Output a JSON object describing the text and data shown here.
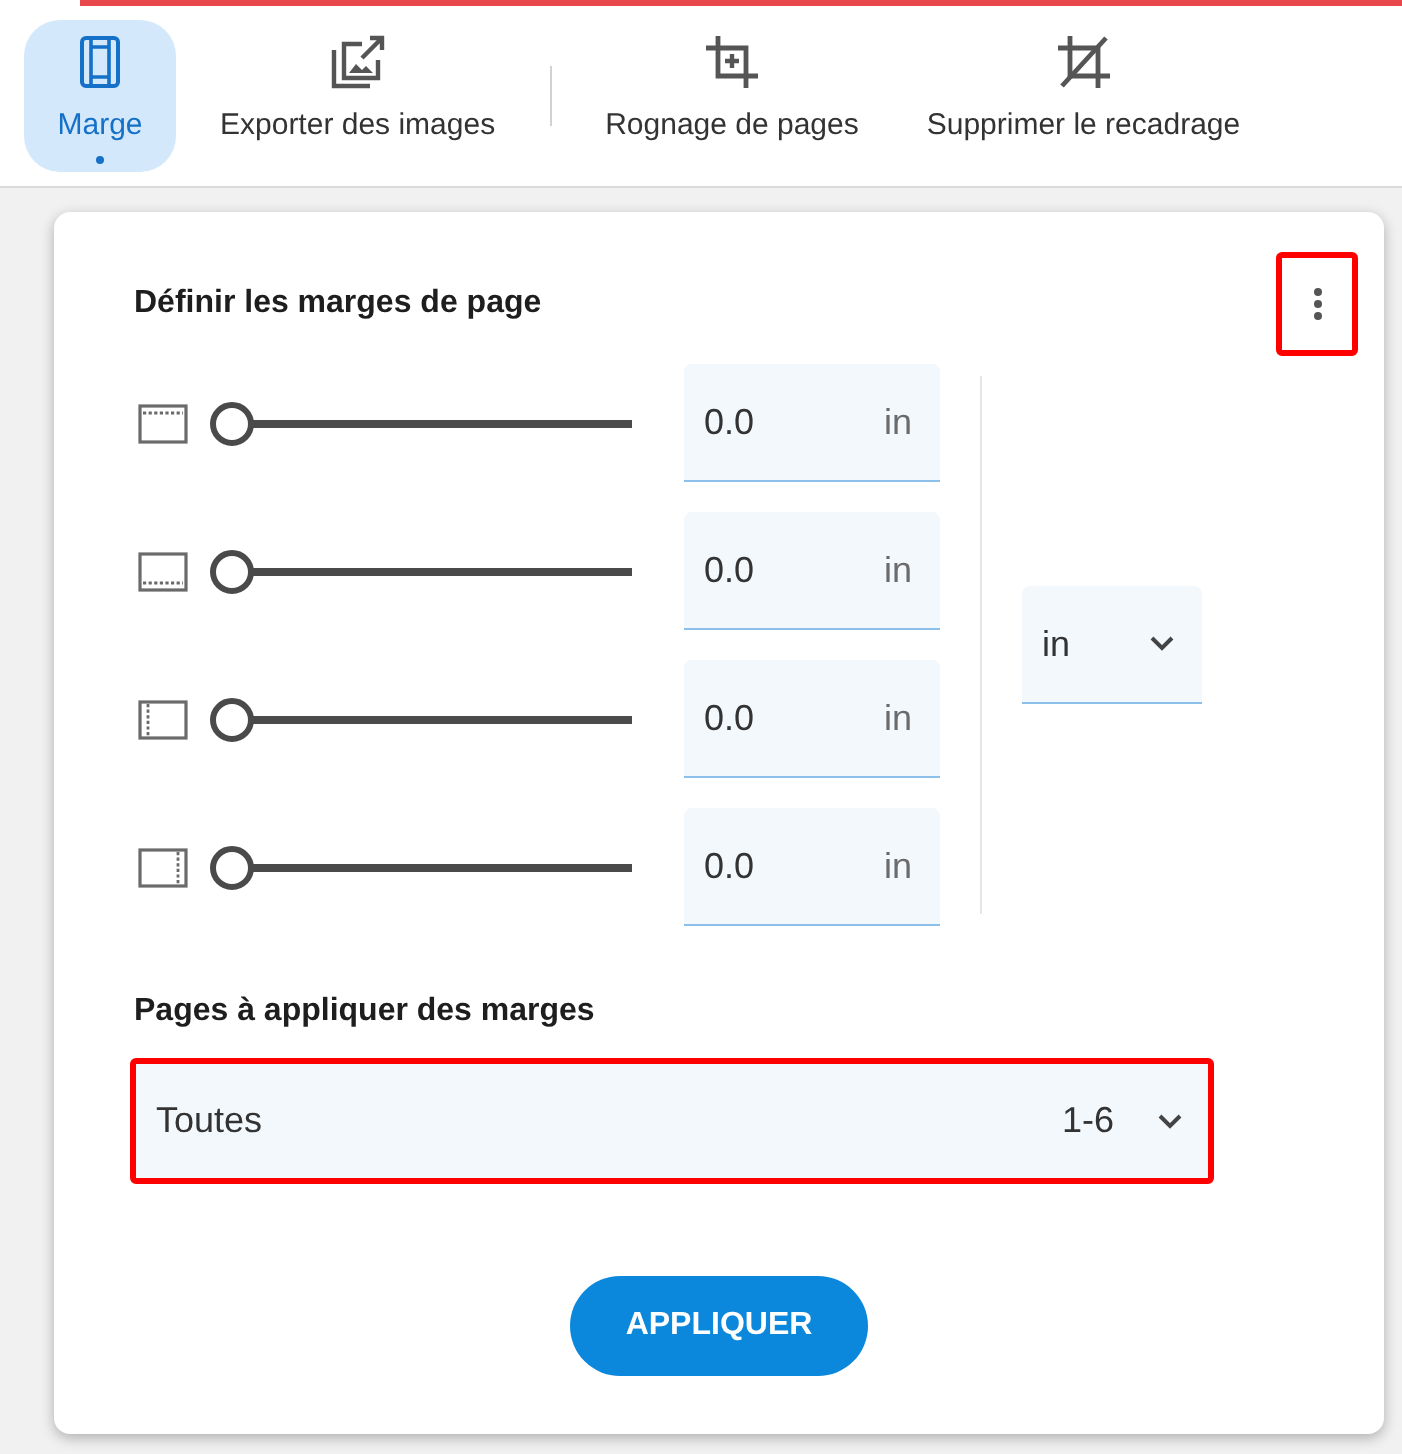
{
  "toolbar": {
    "groups": [
      {
        "items": [
          {
            "kind": "margin",
            "label": "Marge",
            "selected": true
          },
          {
            "kind": "export",
            "label": "Exporter des images",
            "selected": false
          }
        ]
      },
      {
        "items": [
          {
            "kind": "crop",
            "label": "Rognage de pages",
            "selected": false
          },
          {
            "kind": "uncrop",
            "label": "Supprimer le recadrage",
            "selected": false
          }
        ]
      }
    ]
  },
  "margins": {
    "title": "Définir les marges de page",
    "more_button": {
      "highlighted": true
    },
    "rows": [
      {
        "kind": "top",
        "level": 0,
        "value": "0.0",
        "unit": "in"
      },
      {
        "kind": "bottom",
        "level": 0,
        "value": "0.0",
        "unit": "in"
      },
      {
        "kind": "left",
        "level": 0,
        "value": "0.0",
        "unit": "in"
      },
      {
        "kind": "right",
        "level": 0,
        "value": "0.0",
        "unit": "in"
      }
    ],
    "unit_select": {
      "value": "in"
    }
  },
  "pages": {
    "label": "Pages à appliquer des marges",
    "select": {
      "value": "Toutes",
      "range": "1-6",
      "highlighted": true
    }
  },
  "apply_button": {
    "label": "APPLIQUER"
  }
}
